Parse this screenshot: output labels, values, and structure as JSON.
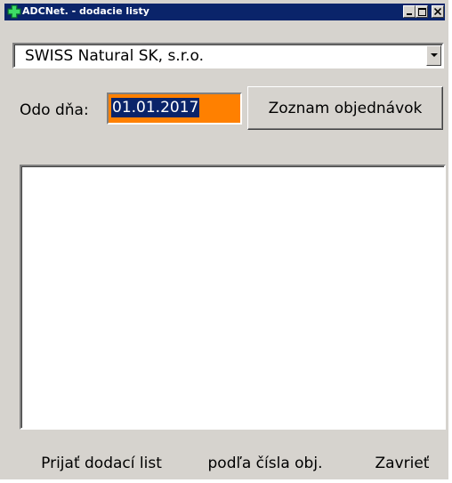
{
  "window": {
    "title": "ADCNet. - dodacie listy",
    "title_bar_color": "#0a246a",
    "icons": [
      "green-cross-icon",
      "minimize-icon",
      "maximize-icon",
      "close-icon"
    ]
  },
  "supplier": {
    "selected": "SWISS Natural SK, s.r.o."
  },
  "date_filter": {
    "label": "Odo dňa:",
    "value": "01.01.2017",
    "field_color": "#ff8000",
    "selection_color": "#0a246a"
  },
  "buttons": {
    "orders_list": "Zoznam objednávok",
    "receive_delivery_note": "Prijať dodací list",
    "by_order_number": "podľa čísla obj.",
    "close": "Zavrieť"
  },
  "list": {
    "items": []
  }
}
